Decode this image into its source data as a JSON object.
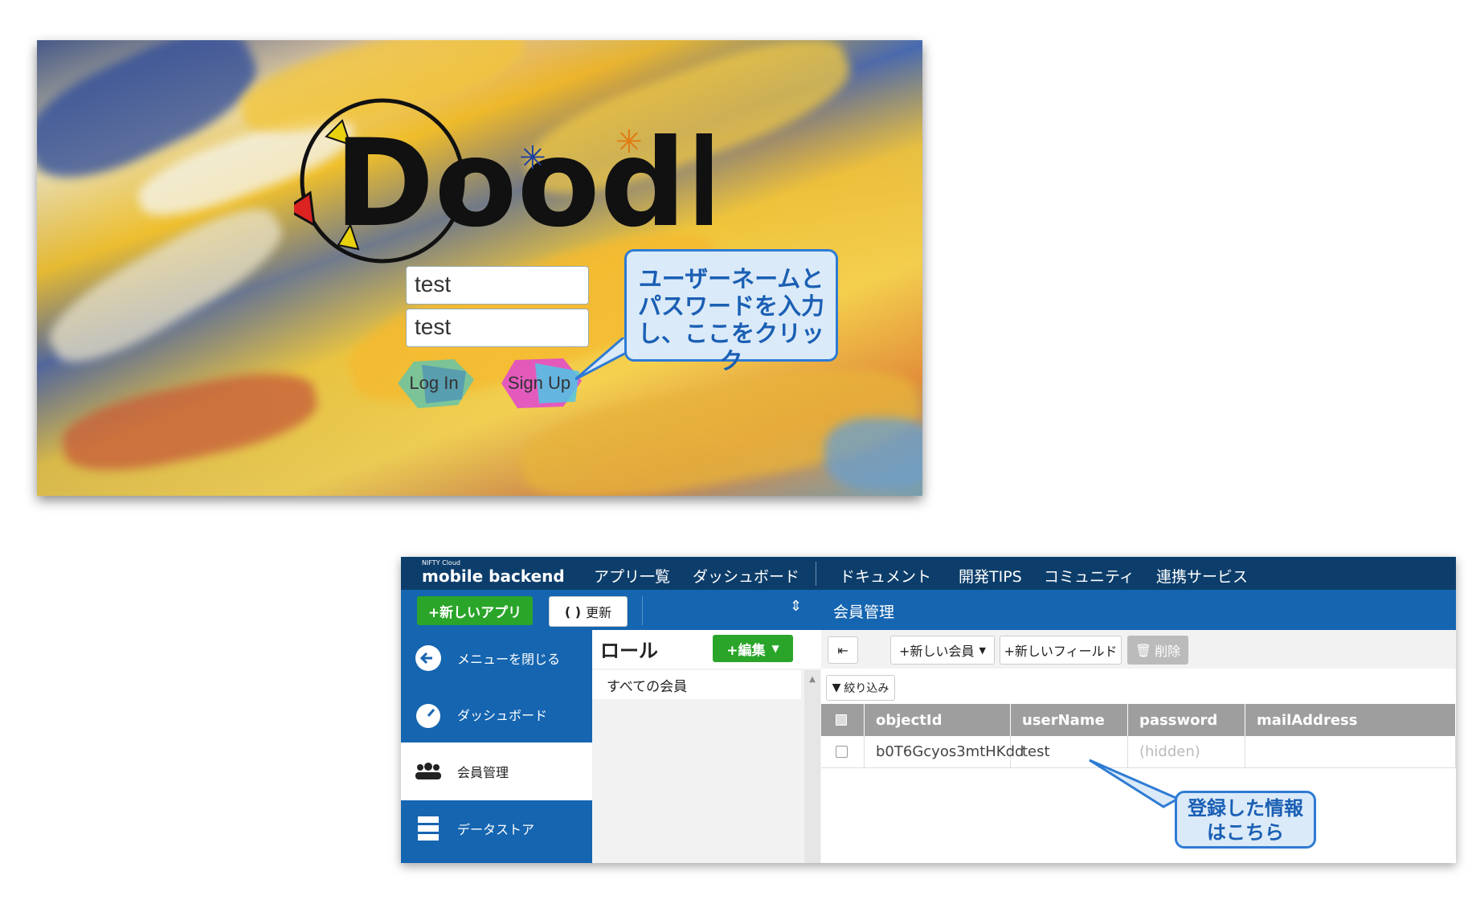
{
  "login": {
    "logo_text": "Doodle",
    "username_value": "test",
    "password_value": "test",
    "login_label": "Log In",
    "signup_label": "Sign Up",
    "callout_lines": [
      "ユーザーネームと",
      "パスワードを入力",
      "し、ここをクリック"
    ]
  },
  "console": {
    "brand_small": "NIFTY Cloud",
    "brand": "mobile backend",
    "nav": [
      "アプリ一覧",
      "ダッシュボード",
      "ドキュメント",
      "開発TIPS",
      "コミュニティ",
      "連携サービス"
    ],
    "new_app_label": "+新しいアプリ",
    "refresh_label": "更新",
    "page_title": "会員管理",
    "sidebar": [
      {
        "label": "メニューを閉じる",
        "icon": "arrow-left-circle-icon"
      },
      {
        "label": "ダッシュボード",
        "icon": "gauge-icon"
      },
      {
        "label": "会員管理",
        "icon": "users-icon"
      },
      {
        "label": "データストア",
        "icon": "database-icon"
      }
    ],
    "roles_title": "ロール",
    "edit_label": "+編集",
    "all_members": "すべての会員",
    "toolbar": {
      "new_member": "+新しい会員",
      "new_field": "+新しいフィールド",
      "delete": "削除",
      "filter": "絞り込み"
    },
    "table": {
      "columns": [
        "objectId",
        "userName",
        "password",
        "mailAddress"
      ],
      "rows": [
        {
          "objectId": "b0T6Gcyos3mtHKdd",
          "userName": "test",
          "password": "(hidden)",
          "mailAddress": ""
        }
      ]
    },
    "callout_lines": [
      "登録した情報",
      "はこちら"
    ]
  },
  "colors": {
    "topbar": "#0d3e6b",
    "primary": "#1565b0",
    "green": "#2aa52a",
    "callout_border": "#2e7bd4",
    "callout_fill": "#dbeaf8"
  }
}
